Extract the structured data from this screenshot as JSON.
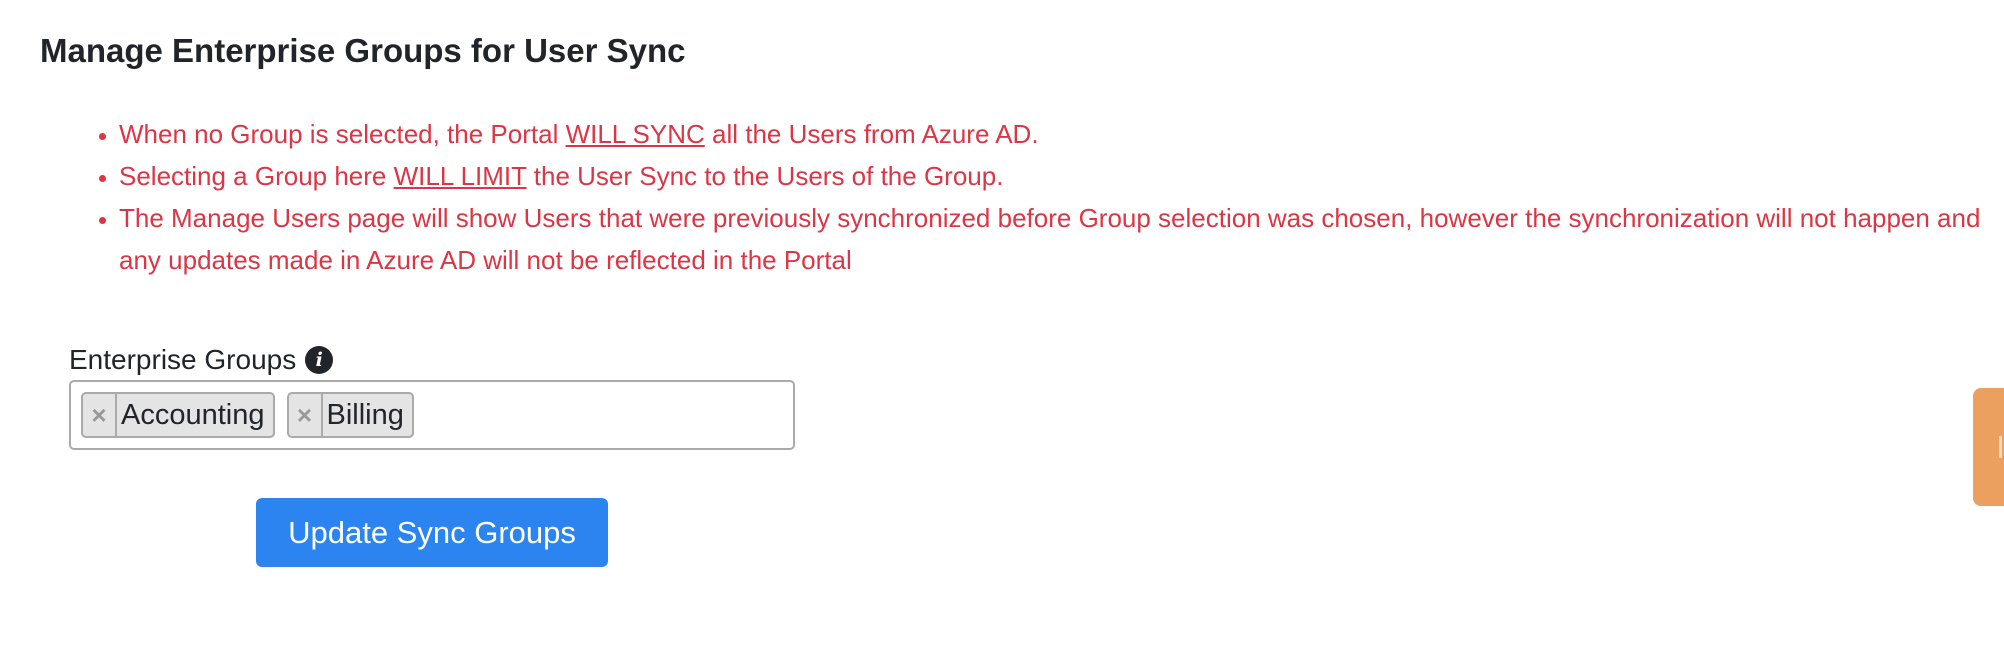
{
  "page": {
    "title": "Manage Enterprise Groups for User Sync"
  },
  "notices": {
    "item1": {
      "before": "When no Group is selected, the Portal ",
      "emphasis": "WILL SYNC",
      "after": " all the Users from Azure AD."
    },
    "item2": {
      "before": "Selecting a Group here ",
      "emphasis": "WILL LIMIT",
      "after": " the User Sync to the Users of the Group."
    },
    "item3": {
      "text": "The Manage Users page will show Users that were previously synchronized before Group selection was chosen, however the synchronization will not happen and any updates made in Azure AD will not be reflected in the Portal"
    }
  },
  "form": {
    "label": "Enterprise Groups",
    "info_icon": "info-circle-icon",
    "remove_symbol": "×",
    "selected_groups": [
      "Accounting",
      "Billing"
    ],
    "submit_label": "Update Sync Groups"
  },
  "colors": {
    "notice_red": "#dc3545",
    "button_blue": "#2b84f0",
    "side_tab_orange": "#eba060"
  }
}
